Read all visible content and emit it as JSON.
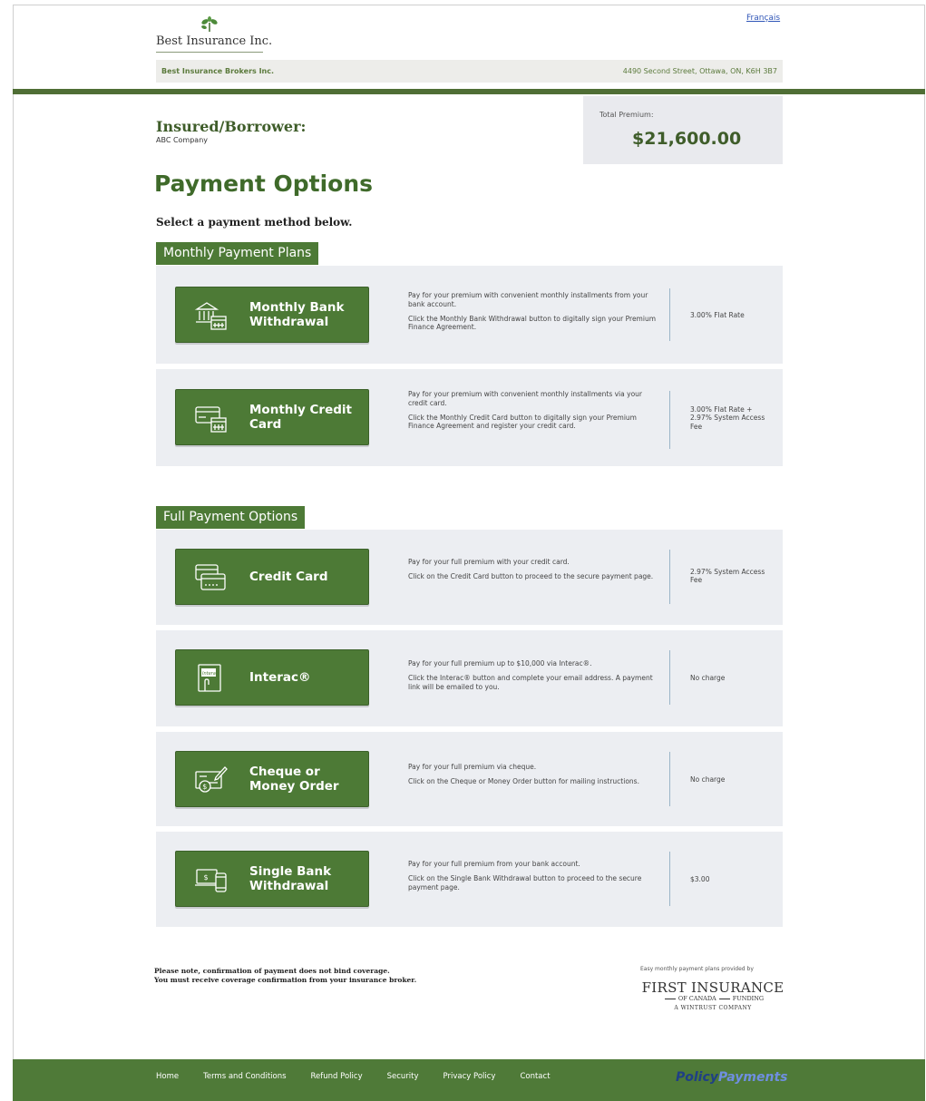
{
  "header": {
    "company_name": "Best Insurance Inc.",
    "language_link": "Français",
    "broker_name": "Best Insurance Brokers Inc.",
    "broker_address": "4490 Second Street, Ottawa, ON, K6H 3B7"
  },
  "insured": {
    "label": "Insured/Borrower:",
    "name": "ABC Company"
  },
  "premium": {
    "label": "Total Premium:",
    "value": "$21,600.00"
  },
  "page_title": "Payment Options",
  "subtitle": "Select a payment method below.",
  "monthly": {
    "heading": "Monthly Payment Plans",
    "options": [
      {
        "button": "Monthly Bank Withdrawal",
        "icon": "bank-calendar-icon",
        "desc1": "Pay for your premium with convenient monthly installments from your bank account.",
        "desc2": "Click the Monthly Bank Withdrawal button to digitally sign your Premium Finance Agreement.",
        "fee": "3.00% Flat Rate"
      },
      {
        "button": "Monthly Credit Card",
        "icon": "credit-card-calendar-icon",
        "desc1": "Pay for your premium with convenient monthly installments via your credit card.",
        "desc2": "Click the Monthly Credit Card button to digitally sign your Premium Finance Agreement and register your credit card.",
        "fee": "3.00% Flat Rate + 2.97% System Access Fee"
      }
    ]
  },
  "full": {
    "heading": "Full Payment Options",
    "options": [
      {
        "button": "Credit Card",
        "icon": "credit-card-icon",
        "desc1": "Pay for your full premium with your credit card.",
        "desc2": "Click on the Credit Card button to proceed to the secure payment page.",
        "fee": "2.97% System Access Fee"
      },
      {
        "button": "Interac®",
        "icon": "interac-icon",
        "desc1": "Pay for your full premium up to $10,000 via Interac®.",
        "desc2": "Click the Interac® button and complete your email address. A payment link will be emailed to you.",
        "fee": "No charge"
      },
      {
        "button": "Cheque or Money Order",
        "icon": "cheque-icon",
        "desc1": "Pay for your full premium via cheque.",
        "desc2": "Click on the Cheque or Money Order button for mailing instructions.",
        "fee": "No charge"
      },
      {
        "button": "Single Bank Withdrawal",
        "icon": "bank-transfer-icon",
        "desc1": "Pay for your full premium from your bank account.",
        "desc2": "Click on the Single Bank Withdrawal button to proceed to the secure payment page.",
        "fee": "$3.00"
      }
    ]
  },
  "notice": {
    "line1": "Please note, confirmation of payment does not bind coverage.",
    "line2": "You must receive coverage confirmation from your insurance broker."
  },
  "provider": {
    "provided_by": "Easy monthly payment plans provided by",
    "logo_name": "FIRST INSURANCE",
    "logo_sub_left": "OF CANADA",
    "logo_sub_right": "FUNDING",
    "logo_tagline": "A WINTRUST COMPANY"
  },
  "footer": {
    "links": [
      "Home",
      "Terms and Conditions",
      "Refund Policy",
      "Security",
      "Privacy Policy",
      "Contact"
    ],
    "brand_part1": "Policy",
    "brand_part2": "Payments"
  },
  "colors": {
    "brand_green": "#4d7a36",
    "dark_green": "#3f5d2a",
    "panel_grey": "#eceef2",
    "link_blue": "#2f55b7"
  }
}
